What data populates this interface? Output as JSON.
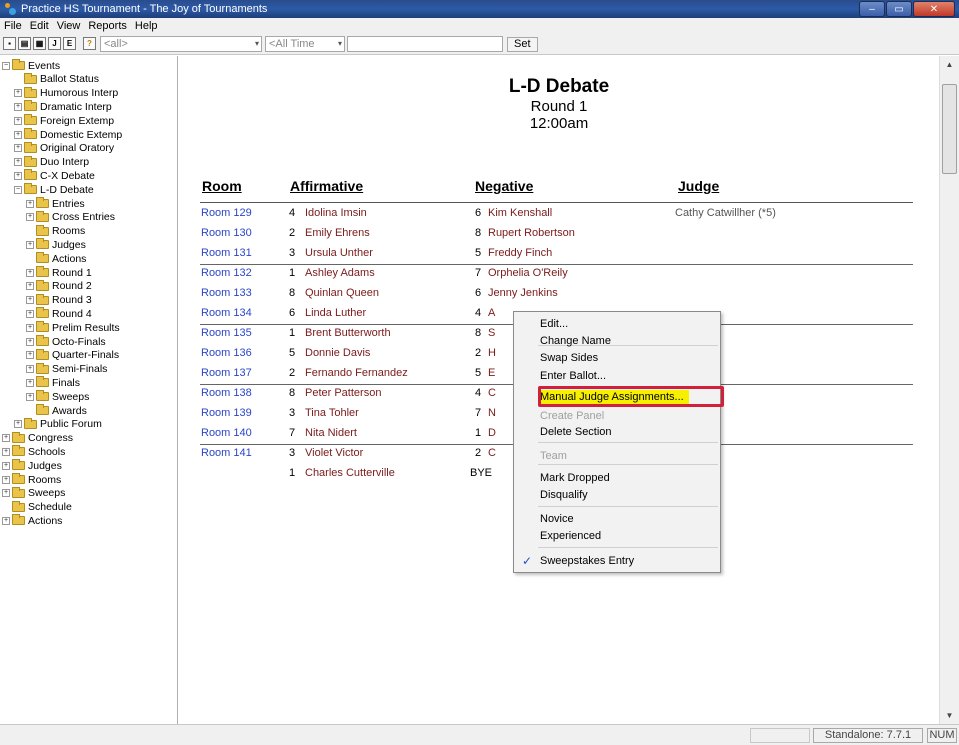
{
  "window": {
    "title": "Practice HS Tournament - The Joy of Tournaments",
    "controls": {
      "minimize": "–",
      "maximize": "▭",
      "close": "✕"
    }
  },
  "menubar": [
    "File",
    "Edit",
    "View",
    "Reports",
    "Help"
  ],
  "toolbar": {
    "buttons": [
      "save-icon",
      "print-icon",
      "grid-icon",
      "J",
      "E",
      "help-icon"
    ],
    "combo1": "<all>",
    "combo2": "<All Time",
    "combo_arrow": "▾",
    "set_label": "Set"
  },
  "tree": [
    {
      "label": "Events",
      "exp": "−",
      "depth": 0
    },
    {
      "label": "Ballot Status",
      "exp": "",
      "depth": 1
    },
    {
      "label": "Humorous Interp",
      "exp": "+",
      "depth": 1
    },
    {
      "label": "Dramatic Interp",
      "exp": "+",
      "depth": 1
    },
    {
      "label": "Foreign Extemp",
      "exp": "+",
      "depth": 1
    },
    {
      "label": "Domestic Extemp",
      "exp": "+",
      "depth": 1
    },
    {
      "label": "Original Oratory",
      "exp": "+",
      "depth": 1
    },
    {
      "label": "Duo Interp",
      "exp": "+",
      "depth": 1
    },
    {
      "label": "C-X Debate",
      "exp": "+",
      "depth": 1
    },
    {
      "label": "L-D Debate",
      "exp": "−",
      "depth": 1
    },
    {
      "label": "Entries",
      "exp": "+",
      "depth": 2
    },
    {
      "label": "Cross Entries",
      "exp": "+",
      "depth": 2
    },
    {
      "label": "Rooms",
      "exp": "",
      "depth": 2
    },
    {
      "label": "Judges",
      "exp": "+",
      "depth": 2
    },
    {
      "label": "Actions",
      "exp": "",
      "depth": 2
    },
    {
      "label": "Round 1",
      "exp": "+",
      "depth": 2
    },
    {
      "label": "Round 2",
      "exp": "+",
      "depth": 2
    },
    {
      "label": "Round 3",
      "exp": "+",
      "depth": 2
    },
    {
      "label": "Round 4",
      "exp": "+",
      "depth": 2
    },
    {
      "label": "Prelim Results",
      "exp": "+",
      "depth": 2
    },
    {
      "label": "Octo-Finals",
      "exp": "+",
      "depth": 2
    },
    {
      "label": "Quarter-Finals",
      "exp": "+",
      "depth": 2
    },
    {
      "label": "Semi-Finals",
      "exp": "+",
      "depth": 2
    },
    {
      "label": "Finals",
      "exp": "+",
      "depth": 2
    },
    {
      "label": "Sweeps",
      "exp": "+",
      "depth": 2
    },
    {
      "label": "Awards",
      "exp": "",
      "depth": 2
    },
    {
      "label": "Public Forum",
      "exp": "+",
      "depth": 1
    },
    {
      "label": "Congress",
      "exp": "+",
      "depth": 0
    },
    {
      "label": "Schools",
      "exp": "+",
      "depth": 0
    },
    {
      "label": "Judges",
      "exp": "+",
      "depth": 0
    },
    {
      "label": "Rooms",
      "exp": "+",
      "depth": 0
    },
    {
      "label": "Sweeps",
      "exp": "+",
      "depth": 0
    },
    {
      "label": "Schedule",
      "exp": "",
      "depth": 0
    },
    {
      "label": "Actions",
      "exp": "+",
      "depth": 0
    }
  ],
  "report": {
    "title": "L-D Debate",
    "round": "Round 1",
    "time": "12:00am",
    "columns": {
      "room": "Room",
      "affirmative": "Affirmative",
      "negative": "Negative",
      "judge": "Judge"
    },
    "rows": [
      {
        "room": "Room 129",
        "aseed": "4",
        "aff": "Idolina Imsin",
        "nseed": "6",
        "neg": "Kim Kenshall",
        "judge": "Cathy Catwillher (*5)",
        "sep": false
      },
      {
        "room": "Room 130",
        "aseed": "2",
        "aff": "Emily Ehrens",
        "nseed": "8",
        "neg": "Rupert Robertson",
        "judge": "",
        "sep": false
      },
      {
        "room": "Room 131",
        "aseed": "3",
        "aff": "Ursula Unther",
        "nseed": "5",
        "neg": "Freddy Finch",
        "judge": "",
        "sep": false
      },
      {
        "room": "Room 132",
        "aseed": "1",
        "aff": "Ashley Adams",
        "nseed": "7",
        "neg": "Orphelia O'Reily",
        "judge": "",
        "sep": true
      },
      {
        "room": "Room 133",
        "aseed": "8",
        "aff": "Quinlan Queen",
        "nseed": "6",
        "neg": "Jenny Jenkins",
        "judge": "",
        "sep": false
      },
      {
        "room": "Room 134",
        "aseed": "6",
        "aff": "Linda Luther",
        "nseed": "4",
        "neg": "A",
        "judge": "",
        "sep": false
      },
      {
        "room": "Room 135",
        "aseed": "1",
        "aff": "Brent Butterworth",
        "nseed": "8",
        "neg": "S",
        "judge": "",
        "sep": true
      },
      {
        "room": "Room 136",
        "aseed": "5",
        "aff": "Donnie Davis",
        "nseed": "2",
        "neg": "H",
        "judge": "",
        "sep": false
      },
      {
        "room": "Room 137",
        "aseed": "2",
        "aff": "Fernando Fernandez",
        "nseed": "5",
        "neg": "E",
        "judge": "",
        "sep": false
      },
      {
        "room": "Room 138",
        "aseed": "8",
        "aff": "Peter Patterson",
        "nseed": "4",
        "neg": "C",
        "judge": "",
        "sep": true
      },
      {
        "room": "Room 139",
        "aseed": "3",
        "aff": "Tina Tohler",
        "nseed": "7",
        "neg": "N",
        "judge": "",
        "sep": false
      },
      {
        "room": "Room 140",
        "aseed": "7",
        "aff": "Nita Nidert",
        "nseed": "1",
        "neg": "D",
        "judge": "",
        "sep": false
      },
      {
        "room": "Room 141",
        "aseed": "3",
        "aff": "Violet Victor",
        "nseed": "2",
        "neg": "C",
        "judge": "",
        "sep": true
      }
    ],
    "bye_row": {
      "seed": "1",
      "name": "Charles Cutterville",
      "bye": "BYE"
    }
  },
  "context_menu": {
    "items": [
      {
        "label": "Edit...",
        "disabled": false
      },
      {
        "label": "Change Name",
        "disabled": false
      },
      {
        "label": "Swap Sides",
        "disabled": false
      },
      {
        "label": "Enter Ballot...",
        "disabled": false
      },
      {
        "label": "Manual Judge Assignments...",
        "disabled": false,
        "highlighted": true
      },
      {
        "label": "Create Panel",
        "disabled": true
      },
      {
        "label": "Delete Section",
        "disabled": false
      },
      {
        "label": "Team",
        "disabled": true
      },
      {
        "label": "Mark Dropped",
        "disabled": false
      },
      {
        "label": "Disqualify",
        "disabled": false
      },
      {
        "label": "Novice",
        "disabled": false
      },
      {
        "label": "Experienced",
        "disabled": false
      },
      {
        "label": "Sweepstakes Entry",
        "disabled": false,
        "checked": true
      }
    ],
    "check_glyph": "✓",
    "highlight_color": "#f6f000",
    "outline_color": "#d0203a"
  },
  "scrollbar": {
    "up": "▲",
    "down": "▼"
  },
  "statusbar": {
    "version": "Standalone: 7.7.1",
    "num": "NUM"
  },
  "colors": {
    "room_link": "#2a46c8",
    "name": "#7a1a1a",
    "title_bar": "#2c5aa8"
  }
}
